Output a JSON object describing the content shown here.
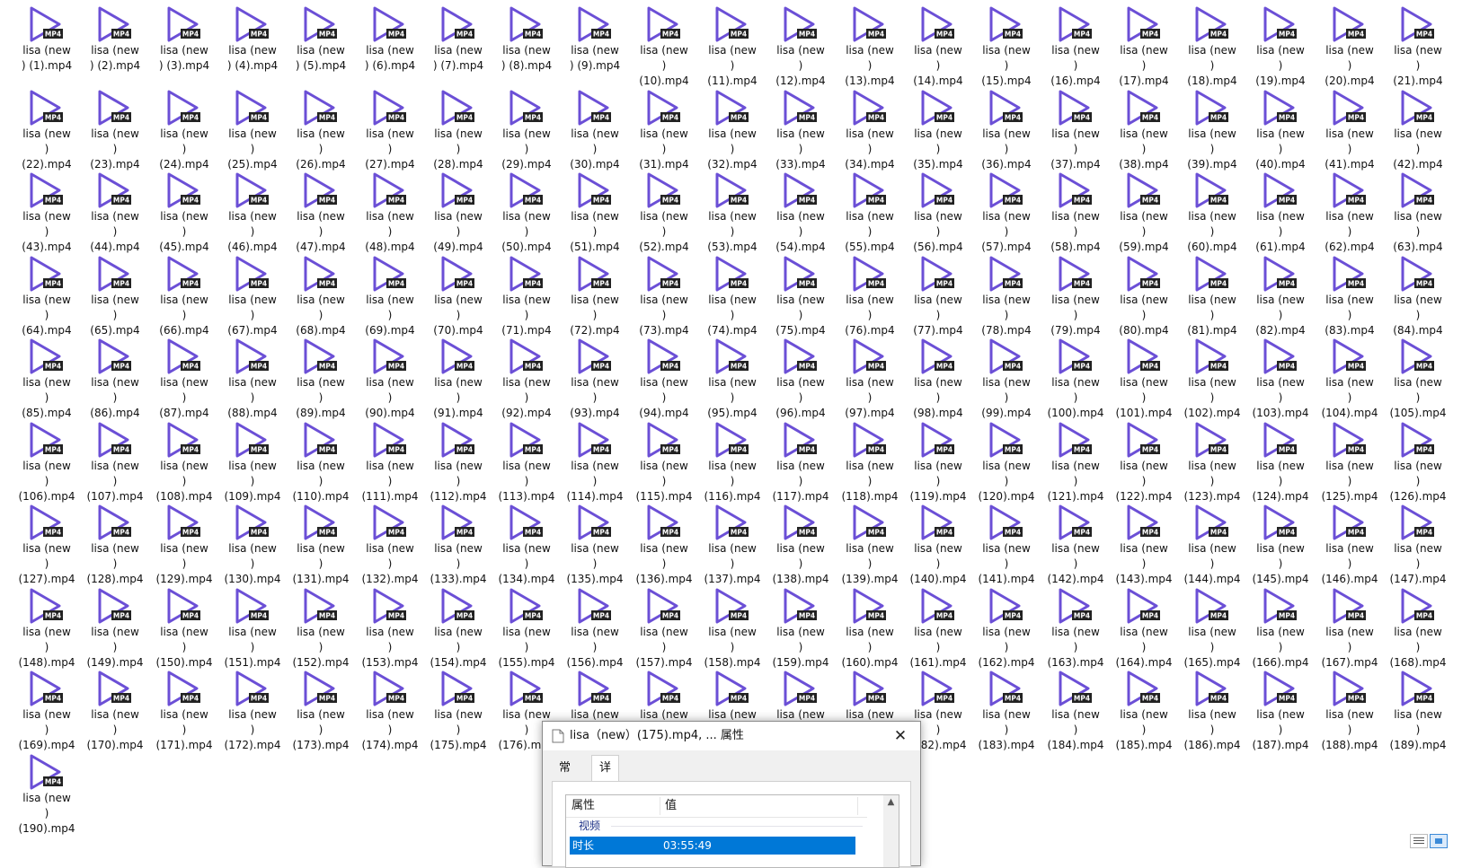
{
  "files": {
    "count": 190,
    "name_prefix": "lisa",
    "name_paren": "(new",
    "name_close": ")",
    "extension": ".mp4",
    "icon": "mp4-video-file-icon",
    "icon_badge": "MP4",
    "icon_color": "#6b4fd6",
    "badge_color": "#222222"
  },
  "dialog": {
    "title": "lisa（new）(175).mp4, ... 属性",
    "close_label": "✕",
    "tabs": [
      {
        "label": "常规"
      },
      {
        "label": "详细信息"
      }
    ],
    "table": {
      "col_property": "属性",
      "col_value": "值",
      "group": "视频",
      "selected_row": {
        "property": "时长",
        "value": "03:55:49"
      }
    }
  }
}
